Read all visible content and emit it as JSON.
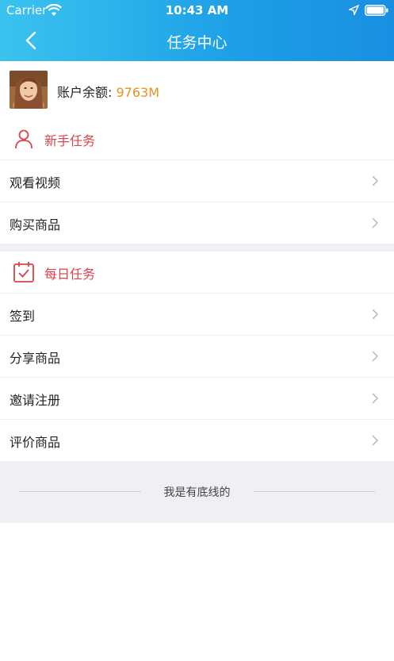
{
  "status_bar": {
    "carrier": "Carrier",
    "time": "10:43 AM"
  },
  "nav": {
    "title": "任务中心"
  },
  "account": {
    "balance_label": "账户余额:",
    "balance_value": "9763M"
  },
  "sections": [
    {
      "title": "新手任务",
      "icon": "user-icon",
      "items": [
        "观看视频",
        "购买商品"
      ]
    },
    {
      "title": "每日任务",
      "icon": "calendar-check-icon",
      "items": [
        "签到",
        "分享商品",
        "邀请注册",
        "评价商品"
      ]
    }
  ],
  "footer": {
    "text": "我是有底线的"
  },
  "colors": {
    "header_start": "#3bc3ef",
    "header_end": "#1a8fe2",
    "accent_red": "#d9434a",
    "balance_orange": "#e8921f",
    "background_gray": "#efeff4"
  }
}
